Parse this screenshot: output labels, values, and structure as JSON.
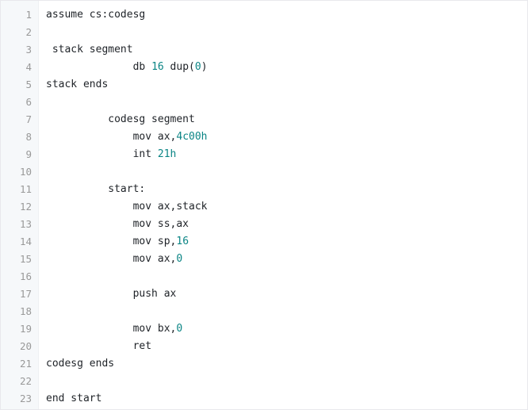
{
  "editor": {
    "colors": {
      "text": "#1f2328",
      "number": "#0b8585",
      "line_number": "#999999",
      "gutter_bg": "#f6f8fa"
    },
    "lines": [
      [
        {
          "t": "assume cs:codesg"
        }
      ],
      [],
      [
        {
          "t": " stack segment"
        }
      ],
      [
        {
          "t": "              db "
        },
        {
          "t": "16",
          "k": "num"
        },
        {
          "t": " dup("
        },
        {
          "t": "0",
          "k": "num"
        },
        {
          "t": ")"
        }
      ],
      [
        {
          "t": "stack ends"
        }
      ],
      [],
      [
        {
          "t": "          codesg segment"
        }
      ],
      [
        {
          "t": "              mov ax,"
        },
        {
          "t": "4c00h",
          "k": "num"
        }
      ],
      [
        {
          "t": "              int "
        },
        {
          "t": "21h",
          "k": "num"
        }
      ],
      [],
      [
        {
          "t": "          start:"
        }
      ],
      [
        {
          "t": "              mov ax,stack"
        }
      ],
      [
        {
          "t": "              mov ss,ax"
        }
      ],
      [
        {
          "t": "              mov sp,"
        },
        {
          "t": "16",
          "k": "num"
        }
      ],
      [
        {
          "t": "              mov ax,"
        },
        {
          "t": "0",
          "k": "num"
        }
      ],
      [],
      [
        {
          "t": "              push ax"
        }
      ],
      [],
      [
        {
          "t": "              mov bx,"
        },
        {
          "t": "0",
          "k": "num"
        }
      ],
      [
        {
          "t": "              ret"
        }
      ],
      [
        {
          "t": "codesg ends"
        }
      ],
      [],
      [
        {
          "t": "end start"
        }
      ]
    ]
  }
}
